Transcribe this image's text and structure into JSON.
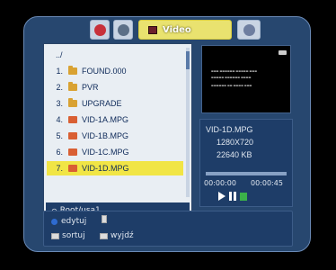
{
  "tabs": [
    {
      "icon": "settings-disc-icon",
      "label": ""
    },
    {
      "icon": "gear-icon",
      "label": ""
    },
    {
      "icon": "video-icon",
      "label": "Video"
    },
    {
      "icon": "user-icon",
      "label": ""
    }
  ],
  "file_list": {
    "parent": "../",
    "items": [
      {
        "num": "1.",
        "type": "folder",
        "name": "FOUND.000"
      },
      {
        "num": "2.",
        "type": "folder",
        "name": "PVR"
      },
      {
        "num": "3.",
        "type": "folder",
        "name": "UPGRADE"
      },
      {
        "num": "4.",
        "type": "video",
        "name": "VID-1A.MPG"
      },
      {
        "num": "5.",
        "type": "video",
        "name": "VID-1B.MPG"
      },
      {
        "num": "6.",
        "type": "video",
        "name": "VID-1C.MPG"
      },
      {
        "num": "7.",
        "type": "video",
        "name": "VID-1D.MPG"
      }
    ],
    "path": "Root/usa1"
  },
  "info": {
    "filename": "VID-1D.MPG",
    "resolution": "1280X720",
    "size": "22640 KB",
    "time_start": "00:00:00",
    "time_end": "00:00:45",
    "progress_percent": 0
  },
  "legend": {
    "edit_label": "edytuj",
    "sort_label": "sortuj",
    "exit_label": "wyjdź"
  }
}
